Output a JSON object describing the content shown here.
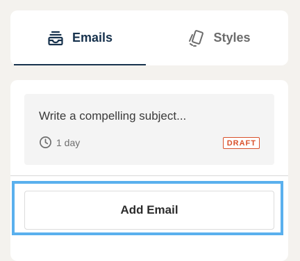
{
  "tabs": {
    "emails": {
      "label": "Emails",
      "icon": "inbox-stack-icon",
      "active": true
    },
    "styles": {
      "label": "Styles",
      "icon": "swatch-cards-icon",
      "active": false
    }
  },
  "emails": [
    {
      "subject": "Write a compelling subject...",
      "duration": "1 day",
      "duration_icon": "clock-icon",
      "status": "DRAFT"
    }
  ],
  "actions": {
    "add_email_label": "Add Email"
  },
  "colors": {
    "active_tab": "#17324d",
    "inactive_tab": "#6b6b6b",
    "draft": "#d9502a",
    "highlight": "#5ab0ee",
    "background": "#f4f2ee"
  }
}
